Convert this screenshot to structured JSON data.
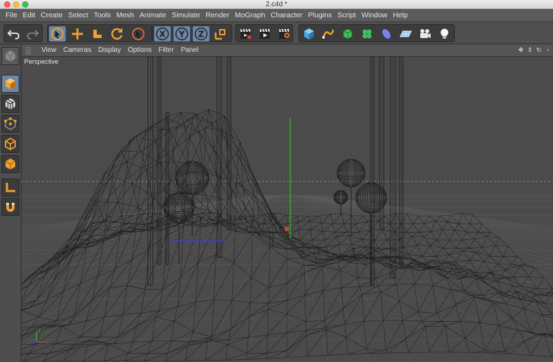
{
  "window": {
    "title": "2.c4d *"
  },
  "menus": [
    "File",
    "Edit",
    "Create",
    "Select",
    "Tools",
    "Mesh",
    "Animate",
    "Simulate",
    "Render",
    "MoGraph",
    "Character",
    "Plugins",
    "Script",
    "Window",
    "Help"
  ],
  "viewport": {
    "menus": [
      "View",
      "Cameras",
      "Display",
      "Options",
      "Filter",
      "Panel"
    ],
    "label": "Perspective"
  },
  "toolbar": {
    "undo_icon": "undo-icon",
    "redo_icon": "redo-icon",
    "axis_x": "X",
    "axis_y": "Y",
    "axis_z": "Z"
  },
  "axis_gizmo": {
    "x": "X",
    "y": "Y",
    "z": "Z"
  },
  "colors": {
    "accent": "#6c87a8",
    "orange": "#f0a030",
    "wire": "#1f1f1f",
    "y_axis": "#2fbf2f",
    "x_axis": "#3c3cd0"
  }
}
